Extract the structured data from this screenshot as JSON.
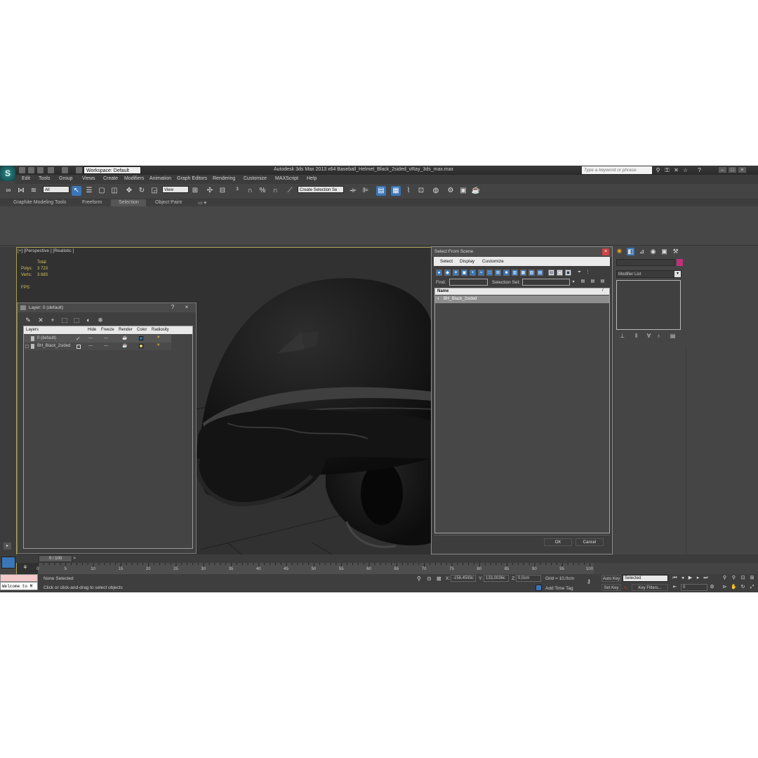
{
  "titlebar": {
    "logo": "S",
    "workspace": "Workspace: Default",
    "title": "Autodesk 3ds Max  2013 x64      Baseball_Helmet_Black_2sided_vRay_3ds_max.max",
    "search_placeholder": "Type a keyword or phrase",
    "min": "–",
    "max": "□",
    "close": "×"
  },
  "menu": [
    "Edit",
    "Tools",
    "Group",
    "Views",
    "Create",
    "Modifiers",
    "Animation",
    "Graph Editors",
    "Rendering",
    "Customize",
    "MAXScript",
    "Help"
  ],
  "toolbar": {
    "filter": "All",
    "refcoord": "View",
    "selection_set": "Create Selection Se"
  },
  "ribbon": {
    "tabs": [
      "Graphite Modeling Tools",
      "Freeform",
      "Selection",
      "Object Paint"
    ],
    "selected_tab": "Selection"
  },
  "viewport": {
    "label": "[+] [Perspective ] [Realistic ]",
    "stats_header": "Total",
    "polys_label": "Polys:",
    "polys_value": "3 723",
    "verts_label": "Verts:",
    "verts_value": "3 683",
    "fps_label": "FPS:"
  },
  "layer_window": {
    "title": "Layer: 0 (default)",
    "help": "?",
    "close": "×",
    "columns": [
      "Layers",
      "Hide",
      "Freeze",
      "Render",
      "Color",
      "Radiosity"
    ],
    "rows": [
      {
        "name": "0 (default)",
        "hide": "—",
        "freeze": "—",
        "color": "#2f6f9a"
      },
      {
        "name": "BH_Black_2sided",
        "hide": "—",
        "freeze": "—",
        "color": "#d8c070"
      }
    ]
  },
  "select_from_scene": {
    "title": "Select From Scene",
    "menus": [
      "Select",
      "Display",
      "Customize"
    ],
    "find_label": "Find:",
    "selection_set_label": "Selection Set:",
    "name_header": "Name",
    "rows": [
      "BH_Black_2sided"
    ],
    "ok": "OK",
    "cancel": "Cancel"
  },
  "command_panel": {
    "modifier_list": "Modifier List",
    "object_color": "#c0307a"
  },
  "timeline": {
    "frame": "0 / 100",
    "next": ">",
    "ticks": [
      "0",
      "5",
      "10",
      "15",
      "20",
      "25",
      "30",
      "35",
      "40",
      "45",
      "50",
      "55",
      "60",
      "65",
      "70",
      "75",
      "80",
      "85",
      "90",
      "95",
      "100"
    ]
  },
  "status": {
    "maxscript": "Welcome to M",
    "selection": "None Selected",
    "prompt": "Click or click-and-drag to select objects",
    "x_label": "X:",
    "x_value": "-158,4593c",
    "y_label": "Y:",
    "y_value": "133,0036c",
    "z_label": "Z:",
    "z_value": "0,0cm",
    "grid": "Grid = 10,0cm",
    "add_time_tag": "Add Time Tag",
    "auto_key": "Auto Key",
    "set_key": "Set Key",
    "selected": "Selected",
    "key_filters": "Key Filters...",
    "current_frame": "0"
  }
}
